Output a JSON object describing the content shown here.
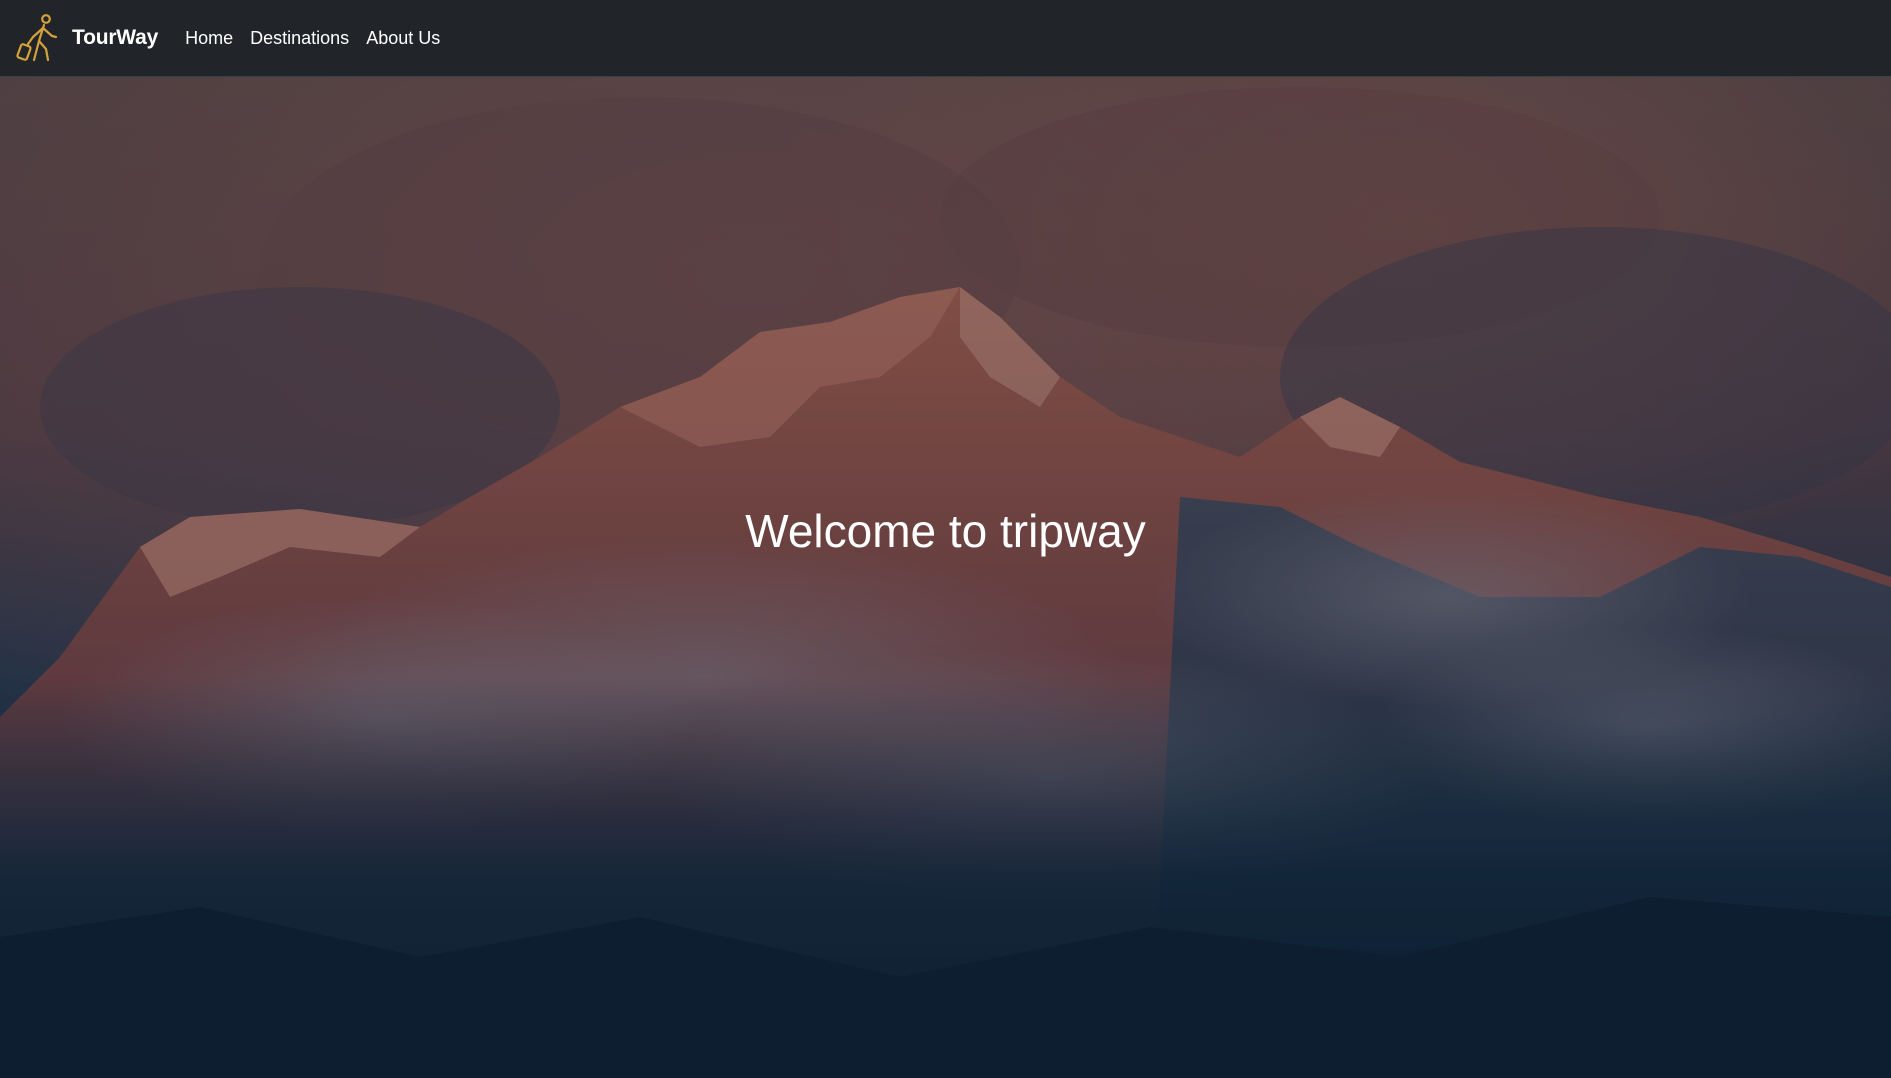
{
  "navbar": {
    "brand": {
      "icon": "walking-traveler-icon",
      "name": "TourWay"
    },
    "links": [
      {
        "label": "Home"
      },
      {
        "label": "Destinations"
      },
      {
        "label": "About Us"
      }
    ]
  },
  "hero": {
    "title": "Welcome to tripway",
    "background": "mountain-sunset-image"
  },
  "colors": {
    "navbar_bg": "#212529",
    "logo_accent": "#d4a13a",
    "text": "#ffffff"
  }
}
